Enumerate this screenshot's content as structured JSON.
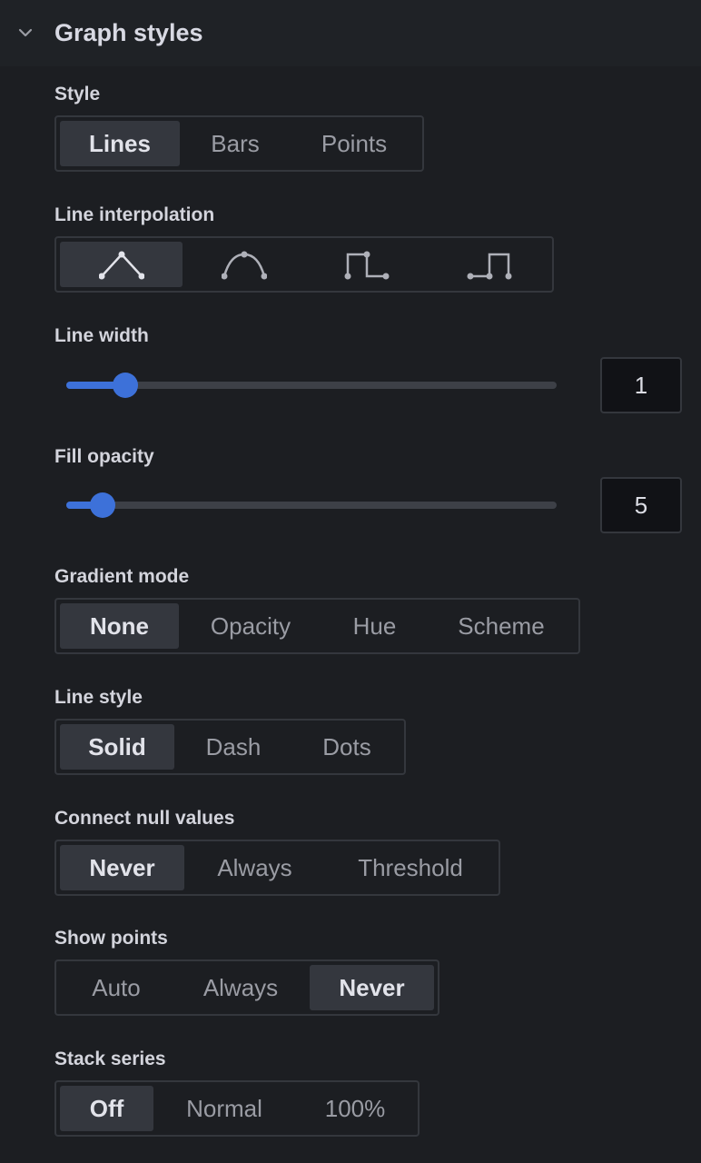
{
  "section": {
    "title": "Graph styles",
    "collapse_icon": "chevron-down-icon"
  },
  "style": {
    "label": "Style",
    "options": [
      "Lines",
      "Bars",
      "Points"
    ],
    "selected": "Lines"
  },
  "line_interpolation": {
    "label": "Line interpolation",
    "options": [
      "linear-icon",
      "smooth-icon",
      "step-before-icon",
      "step-after-icon"
    ],
    "selected": "linear-icon"
  },
  "line_width": {
    "label": "Line width",
    "value": "1",
    "min": 0,
    "max": 10
  },
  "fill_opacity": {
    "label": "Fill opacity",
    "value": "5",
    "min": 0,
    "max": 100
  },
  "gradient_mode": {
    "label": "Gradient mode",
    "options": [
      "None",
      "Opacity",
      "Hue",
      "Scheme"
    ],
    "selected": "None"
  },
  "line_style": {
    "label": "Line style",
    "options": [
      "Solid",
      "Dash",
      "Dots"
    ],
    "selected": "Solid"
  },
  "connect_null_values": {
    "label": "Connect null values",
    "options": [
      "Never",
      "Always",
      "Threshold"
    ],
    "selected": "Never"
  },
  "show_points": {
    "label": "Show points",
    "options": [
      "Auto",
      "Always",
      "Never"
    ],
    "selected": "Never"
  },
  "stack_series": {
    "label": "Stack series",
    "options": [
      "Off",
      "Normal",
      "100%"
    ],
    "selected": "Off"
  },
  "colors": {
    "accent": "#3d71d9",
    "panel_bg": "#1c1e22",
    "header_bg": "#1f2226",
    "active_option_bg": "#34373e"
  }
}
